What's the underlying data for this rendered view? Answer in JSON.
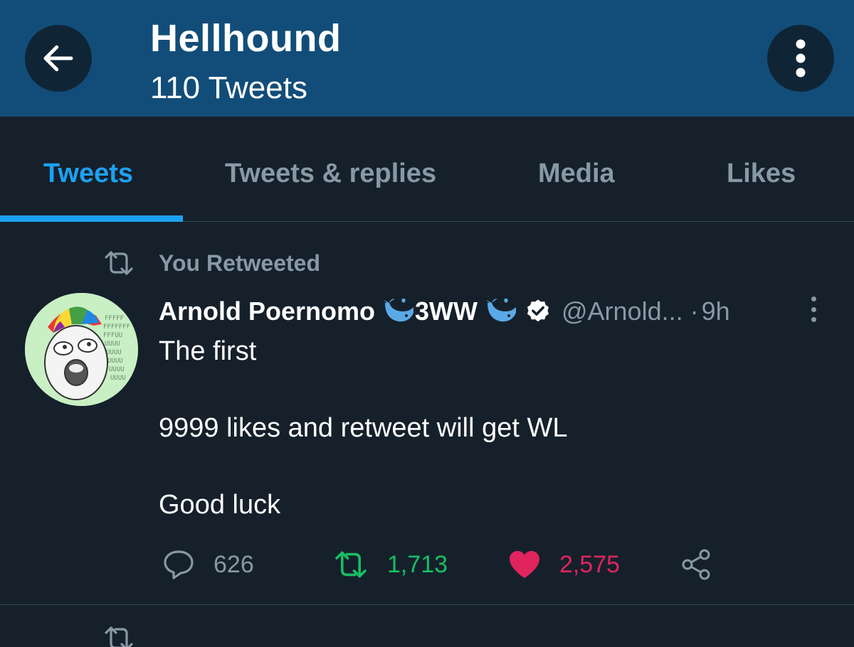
{
  "header": {
    "title": "Hellhound",
    "subtitle": "110 Tweets",
    "back_icon": "arrow-left-icon",
    "more_icon": "more-vertical-icon",
    "background": "#124d79"
  },
  "tabs": [
    {
      "label": "Tweets",
      "active": true
    },
    {
      "label": "Tweets & replies",
      "active": false
    },
    {
      "label": "Media",
      "active": false
    },
    {
      "label": "Likes",
      "active": false
    }
  ],
  "accent_color": "#1da1f2",
  "tweet": {
    "retweet_context": "You Retweeted",
    "author_name": "Arnold Poernomo",
    "author_name_suffix": "3WW",
    "handle": "@Arnold...",
    "separator": "·",
    "time": "9h",
    "lines": [
      "The first",
      "9999 likes and retweet will get WL",
      "Good luck"
    ],
    "replies": "626",
    "retweets": "1,713",
    "likes": "2,575",
    "retweet_color": "#17bf63",
    "like_color": "#e0245e"
  }
}
